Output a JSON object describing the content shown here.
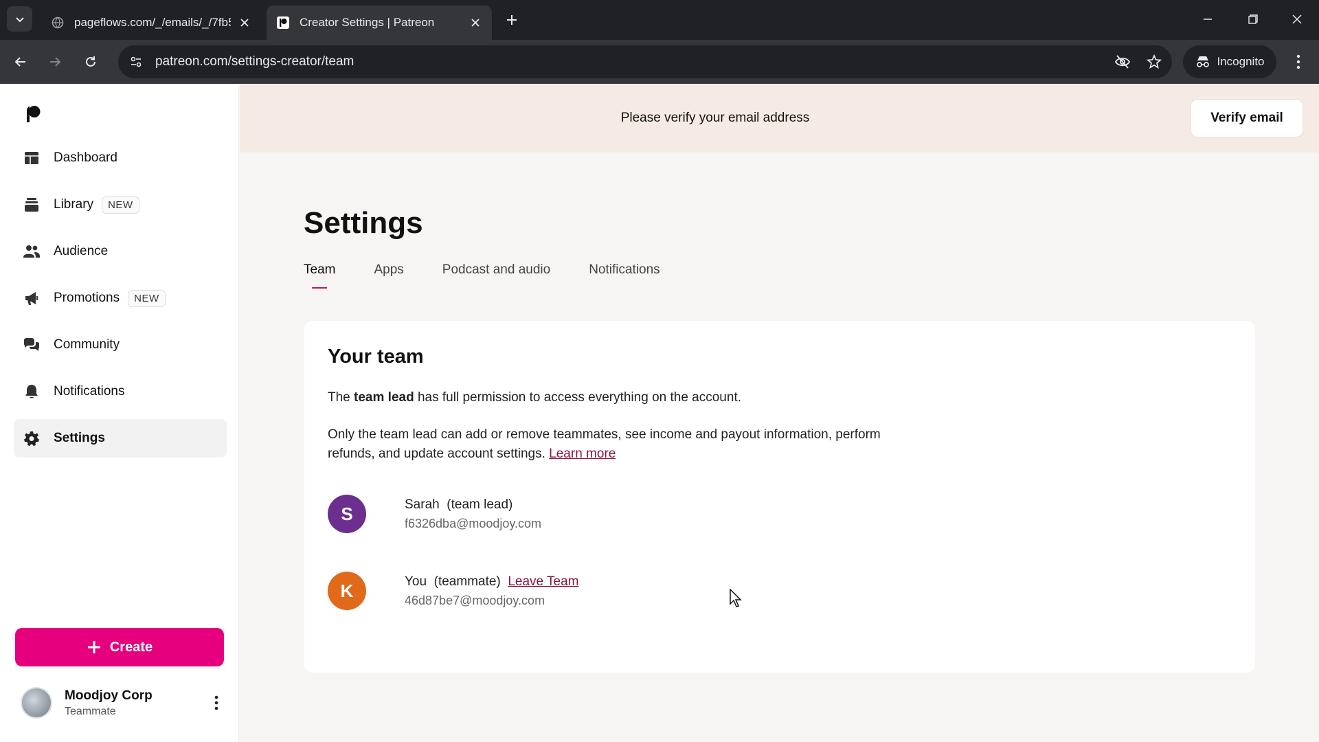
{
  "browser": {
    "tabs": [
      {
        "title": "pageflows.com/_/emails/_/7fb5",
        "active": false
      },
      {
        "title": "Creator Settings | Patreon",
        "active": true
      }
    ],
    "url": "patreon.com/settings-creator/team",
    "incognito_label": "Incognito"
  },
  "sidebar": {
    "items": [
      {
        "label": "Dashboard",
        "icon": "dashboard-icon",
        "badge": ""
      },
      {
        "label": "Library",
        "icon": "library-icon",
        "badge": "NEW"
      },
      {
        "label": "Audience",
        "icon": "audience-icon",
        "badge": ""
      },
      {
        "label": "Promotions",
        "icon": "megaphone-icon",
        "badge": "NEW"
      },
      {
        "label": "Community",
        "icon": "chat-icon",
        "badge": ""
      },
      {
        "label": "Notifications",
        "icon": "bell-icon",
        "badge": ""
      },
      {
        "label": "Settings",
        "icon": "gear-icon",
        "badge": "",
        "active": true
      }
    ],
    "create_label": "Create",
    "account": {
      "name": "Moodjoy Corp",
      "role": "Teammate"
    }
  },
  "banner": {
    "message": "Please verify your email address",
    "button": "Verify email"
  },
  "main": {
    "title": "Settings",
    "tabs": [
      "Team",
      "Apps",
      "Podcast and audio",
      "Notifications"
    ],
    "active_tab": "Team",
    "card": {
      "heading": "Your team",
      "p1_prefix": "The ",
      "p1_bold": "team lead",
      "p1_suffix": " has full permission to access everything on the account.",
      "p2_line1": "Only the team lead can add or remove teammates, see income and payout information, perform",
      "p2_line2": "refunds, and update account settings.",
      "learn_more": "Learn more",
      "members": [
        {
          "initial": "S",
          "name": "Sarah",
          "role": "(team lead)",
          "email": "f6326dba@moodjoy.com",
          "color": "#6c2f8f",
          "action": ""
        },
        {
          "initial": "K",
          "name": "You",
          "role": "(teammate)",
          "email": "46d87be7@moodjoy.com",
          "color": "#e0691a",
          "action": "Leave Team"
        }
      ]
    }
  },
  "colors": {
    "accent": "#e6007e",
    "link": "#8a1538",
    "banner": "#f6ebe4"
  }
}
